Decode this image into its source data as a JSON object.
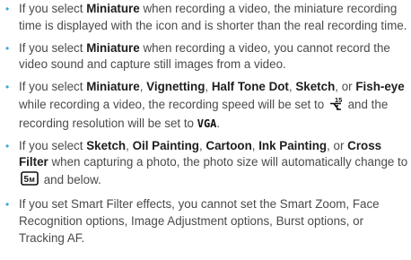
{
  "items": [
    {
      "runs": [
        {
          "t": "If you select "
        },
        {
          "t": "Miniature",
          "b": true
        },
        {
          "t": " when recording a video, the miniature recording time is displayed with the icon and is shorter than the real recording time."
        }
      ]
    },
    {
      "runs": [
        {
          "t": "If you select "
        },
        {
          "t": "Miniature",
          "b": true
        },
        {
          "t": " when recording a video, you cannot record the video sound and capture still images from a video."
        }
      ]
    },
    {
      "runs": [
        {
          "t": "If you select "
        },
        {
          "t": "Miniature",
          "b": true
        },
        {
          "t": ", "
        },
        {
          "t": "Vignetting",
          "b": true
        },
        {
          "t": ", "
        },
        {
          "t": "Half Tone Dot",
          "b": true
        },
        {
          "t": ", "
        },
        {
          "t": "Sketch",
          "b": true
        },
        {
          "t": ", or "
        },
        {
          "t": "Fish-eye",
          "b": true
        },
        {
          "t": " while recording a video, the recording speed will be set to "
        },
        {
          "icon": "frame-rate-15fps-icon"
        },
        {
          "t": " and the recording resolution will be set to "
        },
        {
          "t": "VGA",
          "vga": true
        },
        {
          "t": "."
        }
      ]
    },
    {
      "runs": [
        {
          "t": "If you select "
        },
        {
          "t": "Sketch",
          "b": true
        },
        {
          "t": ", "
        },
        {
          "t": "Oil Painting",
          "b": true
        },
        {
          "t": ", "
        },
        {
          "t": "Cartoon",
          "b": true
        },
        {
          "t": ", "
        },
        {
          "t": "Ink Painting",
          "b": true
        },
        {
          "t": ", or "
        },
        {
          "t": "Cross Filter",
          "b": true
        },
        {
          "t": " when capturing a photo, the photo size will automatically change to "
        },
        {
          "icon": "photo-size-5m-icon"
        },
        {
          "t": " and below."
        }
      ]
    },
    {
      "runs": [
        {
          "t": "If you set Smart Filter effects, you cannot set the Smart Zoom, Face Recognition options, Image Adjustment options, Burst options, or Tracking AF."
        }
      ]
    }
  ]
}
